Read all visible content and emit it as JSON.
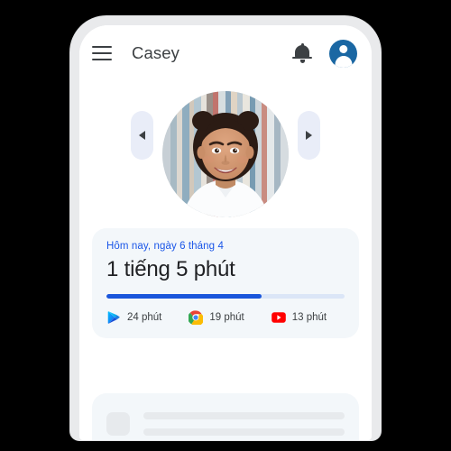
{
  "app": {
    "title": "Casey",
    "menu_icon": "hamburger-menu-icon",
    "bell_icon": "notification-bell-icon",
    "avatar_icon": "user-avatar-icon"
  },
  "carousel": {
    "prev_label": "◀",
    "next_label": "▶",
    "photo_alt": "child-profile-photo"
  },
  "summary": {
    "date_label": "Hôm nay, ngày 6 tháng 4",
    "total_time": "1 tiếng 5 phút",
    "progress_percent": 65,
    "apps": [
      {
        "name": "play-store",
        "label": "24 phút",
        "minutes": 24
      },
      {
        "name": "chrome",
        "label": "19 phút",
        "minutes": 19
      },
      {
        "name": "youtube",
        "label": "13 phút",
        "minutes": 13
      }
    ]
  },
  "colors": {
    "accent_blue": "#1a56db",
    "link_blue": "#1a56e8",
    "card_bg": "#f3f7fa",
    "track_bg": "#dbe6f7",
    "text_dark": "#202124",
    "avatar_bg": "#1a67a3",
    "pill_bg": "#e9edf8",
    "frame_gray": "#e9eaec",
    "backdrop": "#000000"
  }
}
